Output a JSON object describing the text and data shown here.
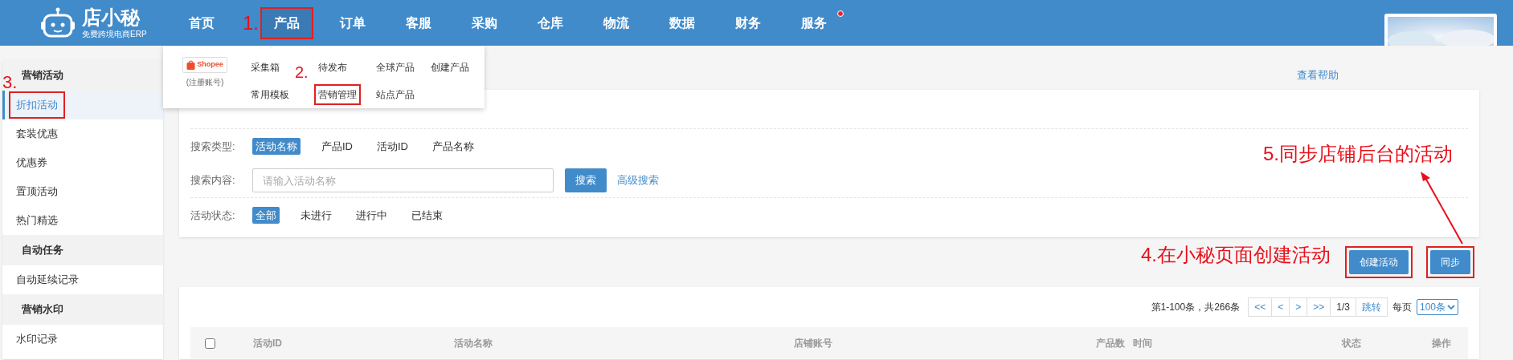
{
  "logo": {
    "name": "店小秘",
    "tagline": "免费跨境电商ERP"
  },
  "nav": [
    {
      "label": "首页",
      "highlighted": false,
      "badge": false
    },
    {
      "label": "产品",
      "highlighted": true,
      "badge": false
    },
    {
      "label": "订单",
      "highlighted": false,
      "badge": false
    },
    {
      "label": "客服",
      "highlighted": false,
      "badge": false
    },
    {
      "label": "采购",
      "highlighted": false,
      "badge": false
    },
    {
      "label": "仓库",
      "highlighted": false,
      "badge": false
    },
    {
      "label": "物流",
      "highlighted": false,
      "badge": false
    },
    {
      "label": "数据",
      "highlighted": false,
      "badge": false
    },
    {
      "label": "财务",
      "highlighted": false,
      "badge": false
    },
    {
      "label": "服务",
      "highlighted": false,
      "badge": true
    }
  ],
  "dropdown": {
    "platform": "Shopee",
    "platform_note": "(注册账号)",
    "items": [
      {
        "label": "采集箱",
        "highlighted": false
      },
      {
        "label": "待发布",
        "highlighted": false
      },
      {
        "label": "全球产品",
        "highlighted": false
      },
      {
        "label": "创建产品",
        "highlighted": false
      },
      {
        "label": "常用模板",
        "highlighted": false
      },
      {
        "label": "营销管理",
        "highlighted": true
      },
      {
        "label": "站点产品",
        "highlighted": false
      }
    ]
  },
  "sidebar": [
    {
      "title": "营销活动",
      "items": [
        {
          "label": "折扣活动",
          "selected": true,
          "highlighted": true
        },
        {
          "label": "套装优惠",
          "selected": false,
          "highlighted": false
        },
        {
          "label": "优惠券",
          "selected": false,
          "highlighted": false
        },
        {
          "label": "置顶活动",
          "selected": false,
          "highlighted": false
        },
        {
          "label": "热门精选",
          "selected": false,
          "highlighted": false
        }
      ]
    },
    {
      "title": "自动任务",
      "items": [
        {
          "label": "自动延续记录",
          "selected": false,
          "highlighted": false
        }
      ]
    },
    {
      "title": "营销水印",
      "items": [
        {
          "label": "水印记录",
          "selected": false,
          "highlighted": false
        }
      ]
    }
  ],
  "help_link": "查看帮助",
  "filters": [
    {
      "label": "搜索类型:",
      "options": [
        {
          "label": "活动名称",
          "selected": true
        },
        {
          "label": "产品ID",
          "selected": false
        },
        {
          "label": "活动ID",
          "selected": false
        },
        {
          "label": "产品名称",
          "selected": false
        }
      ]
    },
    {
      "label": "搜索内容:",
      "placeholder": "请输入活动名称",
      "button": "搜索",
      "link": "高级搜索"
    },
    {
      "label": "活动状态:",
      "options": [
        {
          "label": "全部",
          "selected": true
        },
        {
          "label": "未进行",
          "selected": false
        },
        {
          "label": "进行中",
          "selected": false
        },
        {
          "label": "已结束",
          "selected": false
        }
      ]
    }
  ],
  "actions": [
    {
      "label": "创建活动",
      "highlighted": true
    },
    {
      "label": "同步",
      "highlighted": true
    }
  ],
  "pagination": {
    "summary": "第1-100条，共266条",
    "buttons": [
      "<<",
      "<",
      ">",
      ">>"
    ],
    "page": "1/3",
    "jump": "跳转",
    "per_page_label": "每页",
    "per_page": "100条"
  },
  "table": {
    "select_all": {
      "checked": false
    },
    "columns": [
      "活动ID",
      "活动名称",
      "店铺账号",
      "产品数",
      "时间",
      "状态",
      "操作"
    ]
  },
  "steps": [
    "1.",
    "2.",
    "3.",
    "4.在小秘页面创建活动",
    "5.同步店铺后台的活动"
  ]
}
